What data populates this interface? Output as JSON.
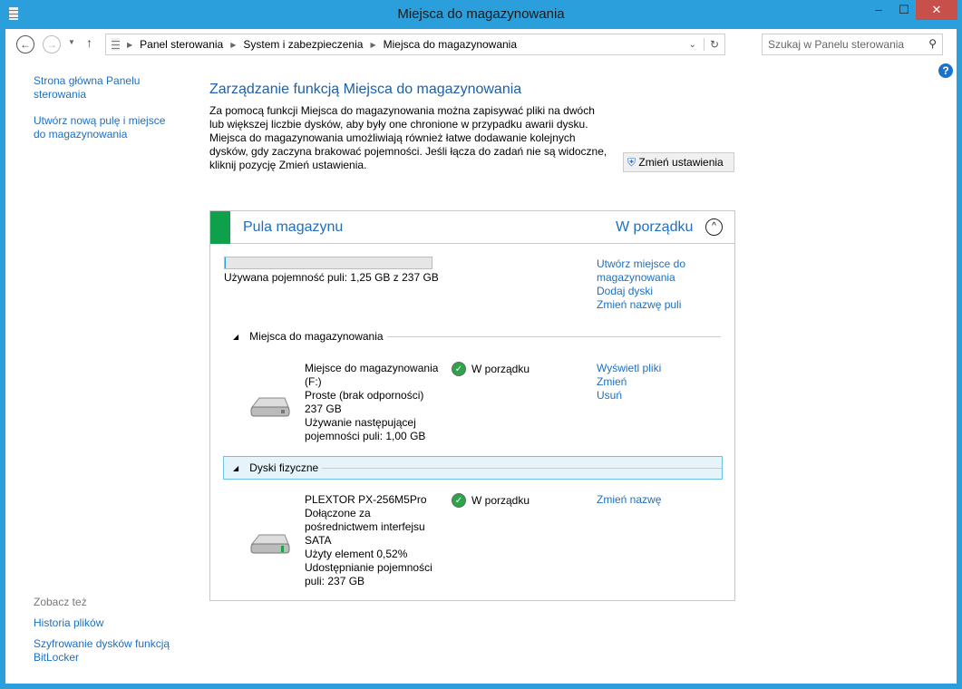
{
  "window": {
    "title": "Miejsca do magazynowania",
    "minimize": "–",
    "maximize": "☐",
    "close": "✕"
  },
  "address": {
    "breadcrumb": [
      "Panel sterowania",
      "System i zabezpieczenia",
      "Miejsca do magazynowania"
    ],
    "search_placeholder": "Szukaj w Panelu sterowania"
  },
  "sidebar": {
    "links": [
      "Strona główna Panelu sterowania",
      "Utwórz nową pulę i miejsce do magazynowania"
    ],
    "see_also": "Zobacz też",
    "see_also_links": [
      "Historia plików",
      "Szyfrowanie dysków funkcją BitLocker"
    ]
  },
  "main": {
    "heading": "Zarządzanie funkcją Miejsca do magazynowania",
    "description": "Za pomocą funkcji Miejsca do magazynowania można zapisywać pliki na dwóch lub większej liczbie dysków, aby były one chronione w przypadku awarii dysku. Miejsca do magazynowania umożliwiają również łatwe dodawanie kolejnych dysków, gdy zaczyna brakować pojemności. Jeśli łącza do zadań nie są widoczne, kliknij pozycję Zmień ustawienia.",
    "change_settings": "Zmień ustawienia"
  },
  "pool": {
    "name": "Pula magazynu",
    "status": "W porządku",
    "used_fraction": 0.0053,
    "usage": "Używana pojemność puli: 1,25 GB z 237 GB",
    "actions": [
      "Utwórz miejsce do magazynowania",
      "Dodaj dyski",
      "Zmień nazwę puli"
    ],
    "accent": "#0ea04b"
  },
  "spaces": {
    "header": "Miejsca do magazynowania",
    "item": {
      "lines": [
        "Miejsce do magazynowania (F:)",
        "Proste (brak odporności)",
        "237 GB",
        "Używanie następującej pojemności puli: 1,00 GB"
      ],
      "status": "W porządku",
      "actions": [
        "Wyświetl pliki",
        "Zmień",
        "Usuń"
      ]
    }
  },
  "disks": {
    "header": "Dyski fizyczne",
    "item": {
      "lines": [
        "PLEXTOR PX-256M5Pro",
        "Dołączone za pośrednictwem interfejsu SATA",
        "Użyty element 0,52%",
        "Udostępnianie pojemności puli: 237 GB"
      ],
      "status": "W porządku",
      "actions": [
        "Zmień nazwę"
      ]
    }
  }
}
